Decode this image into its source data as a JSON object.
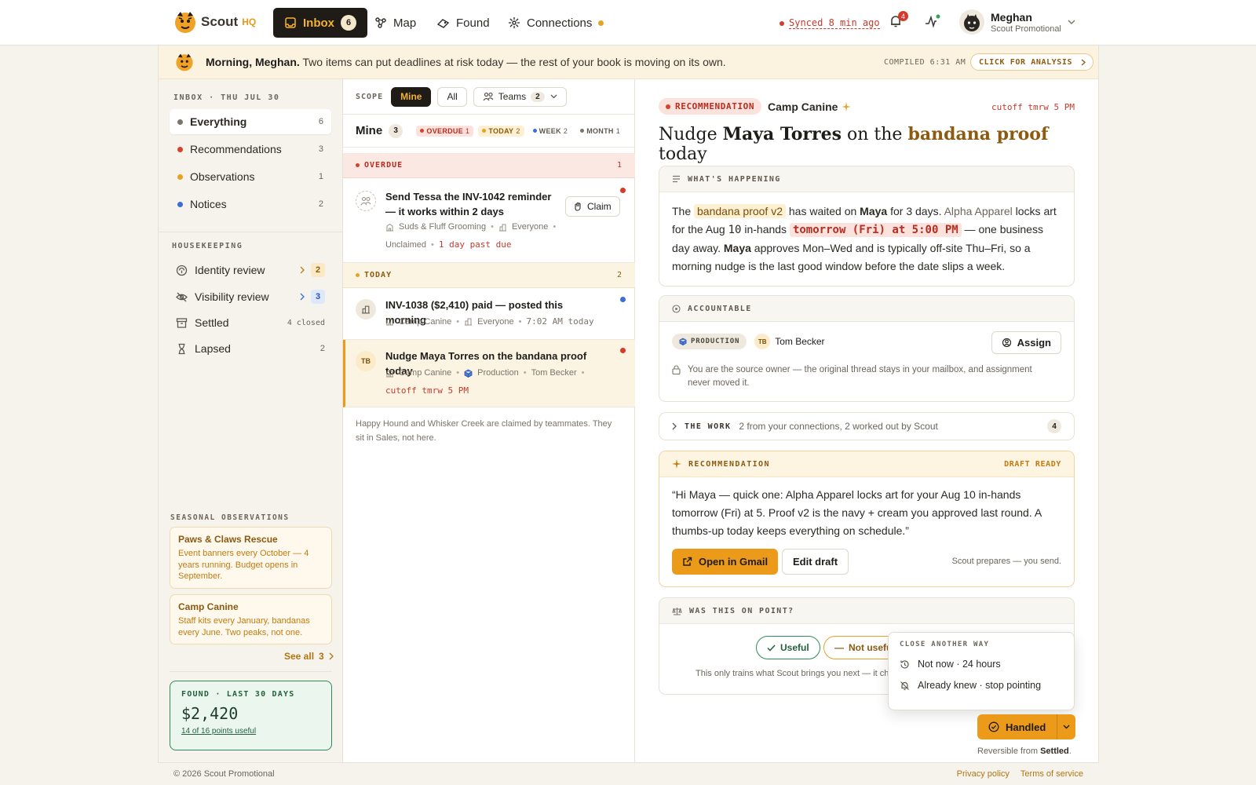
{
  "brand": {
    "name": "Scout",
    "suffix": "HQ"
  },
  "nav": {
    "inbox": {
      "label": "Inbox",
      "count": "6"
    },
    "map": {
      "label": "Map"
    },
    "found": {
      "label": "Found"
    },
    "connections": {
      "label": "Connections"
    },
    "sync_status": "Synced 8 min ago",
    "notifications_count": "4",
    "user": {
      "name": "Meghan",
      "org": "Scout Promotional"
    }
  },
  "banner": {
    "greeting": "Morning, Meghan.",
    "message": " Two items can put deadlines at risk today — the rest of your book is moving on its own.",
    "compiled": "COMPILED 6:31 AM",
    "analysis_label": "CLICK FOR ANALYSIS"
  },
  "sidebar": {
    "inbox_heading": "INBOX · THU JUL 30",
    "items": [
      {
        "label": "Everything",
        "count": "6",
        "color": "#7a746b"
      },
      {
        "label": "Recommendations",
        "count": "3",
        "color": "#d4432c"
      },
      {
        "label": "Observations",
        "count": "1",
        "color": "#e6a321"
      },
      {
        "label": "Notices",
        "count": "2",
        "color": "#3a6fd8"
      }
    ],
    "housekeeping_heading": "HOUSEKEEPING",
    "housekeeping": [
      {
        "label": "Identity review",
        "count": "2"
      },
      {
        "label": "Visibility review",
        "count": "3"
      },
      {
        "label": "Settled",
        "count": "4 closed"
      },
      {
        "label": "Lapsed",
        "count": "2"
      }
    ],
    "seasonal_heading": "SEASONAL OBSERVATIONS",
    "seasonal": [
      {
        "title": "Paws & Claws Rescue",
        "desc": "Event banners every October — 4 years running. Budget opens in September."
      },
      {
        "title": "Camp Canine",
        "desc": "Staff kits every January, bandanas every June. Two peaks, not one."
      }
    ],
    "see_all": "See all",
    "see_all_count": "3",
    "found": {
      "label": "FOUND · LAST 30 DAYS",
      "value": "$2,420",
      "sub": "14 of 16 points useful"
    }
  },
  "list": {
    "scope_label": "SCOPE",
    "scope_mine": "Mine",
    "scope_all": "All",
    "scope_teams": "Teams",
    "teams_count": "2",
    "header_title": "Mine",
    "header_count": "3",
    "chips": {
      "overdue": {
        "label": "OVERDUE",
        "count": "1"
      },
      "today": {
        "label": "TODAY",
        "count": "2"
      },
      "week": {
        "label": "WEEK",
        "count": "2"
      },
      "month": {
        "label": "MONTH",
        "count": "1"
      }
    },
    "groups": {
      "overdue": {
        "label": "OVERDUE",
        "count": "1"
      },
      "today": {
        "label": "TODAY",
        "count": "2"
      }
    },
    "items": [
      {
        "title": "Send Tessa the INV-1042 reminder — it works within 2 days",
        "client": "Suds & Fluff Grooming",
        "audience": "Everyone",
        "owner": "Unclaimed",
        "due": "1 day past due",
        "claim": "Claim"
      },
      {
        "title": "INV-1038 ($2,410) paid — posted this morning",
        "client": "Camp Canine",
        "audience": "Everyone",
        "time": "7:02 AM today"
      },
      {
        "title": "Nudge Maya Torres on the bandana proof today",
        "client": "Camp Canine",
        "team": "Production",
        "person": "Tom Becker",
        "due": "cutoff tmrw 5 PM",
        "initials": "TB"
      }
    ],
    "footer_note": "Happy Hound and Whisker Creek are claimed by teammates. They sit in Sales, not here."
  },
  "detail": {
    "pill": "RECOMMENDATION",
    "client": "Camp Canine",
    "cutoff": "cutoff tmrw 5 PM",
    "title_pre": "Nudge ",
    "title_name": "Maya Torres",
    "title_mid": " on the ",
    "title_hl": "bandana proof",
    "title_post": " today",
    "happening": {
      "heading": "WHAT'S HAPPENING",
      "p1": "The ",
      "tag1": "bandana proof v2",
      "p2": " has waited on ",
      "name1": "Maya",
      "p3": " for 3 days. ",
      "company": "Alpha Apparel",
      "p4": " locks art for the Aug ",
      "day": "10",
      "p5": " in-hands ",
      "tag2": "tomorrow (Fri) at 5:00 PM",
      "p6": " — one business day away. ",
      "name2": "Maya",
      "p7": " approves Mon–Wed and is typically off-site Thu–Fri, so a morning nudge is the last good window before the date slips a week."
    },
    "accountable": {
      "heading": "ACCOUNTABLE",
      "team": "PRODUCTION",
      "initials": "TB",
      "person": "Tom Becker",
      "assign": "Assign",
      "note": "You are the source owner — the original thread stays in your mailbox, and assignment never moved it."
    },
    "work": {
      "label": "THE WORK",
      "sub": "2 from your connections, 2 worked out by Scout",
      "count": "4"
    },
    "recommendation": {
      "heading": "RECOMMENDATION",
      "status": "DRAFT READY",
      "draft": "“Hi Maya — quick one: Alpha Apparel locks art for your Aug 10 in-hands tomorrow (Fri) at 5. Proof v2 is the navy + cream you approved last round. A thumbs-up today keeps everything on schedule.”",
      "open_gmail": "Open in Gmail",
      "edit_draft": "Edit draft",
      "prep": "Scout prepares — you send."
    },
    "feedback": {
      "heading": "WAS THIS ON POINT?",
      "useful": "Useful",
      "not_useful": "Not useful",
      "note": "This only trains what Scout brings you next — it changes nothing else."
    },
    "popover": {
      "heading": "CLOSE ANOTHER WAY",
      "opt1": "Not now · 24 hours",
      "opt2": "Already knew · stop pointing"
    },
    "handled": "Handled",
    "reversible_pre": "Reversible from ",
    "reversible_where": "Settled",
    "reversible_post": "."
  },
  "footer": {
    "copyright": "© 2026 Scout Promotional",
    "privacy": "Privacy policy",
    "terms": "Terms of service"
  }
}
